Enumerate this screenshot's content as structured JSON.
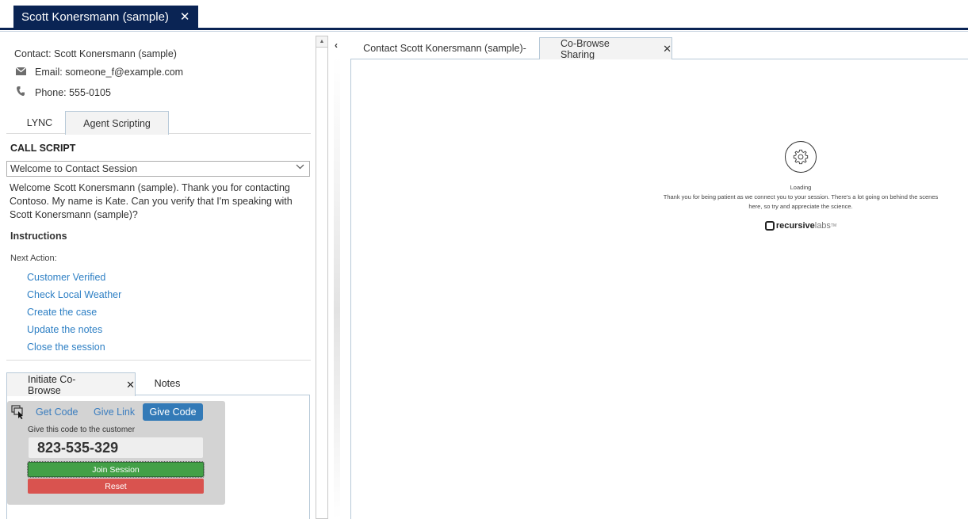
{
  "session_tab": {
    "label": "Scott Konersmann (sample)",
    "close_glyph": "✕"
  },
  "contact": {
    "title": "Contact: Scott Konersmann (sample)",
    "email": "Email: someone_f@example.com",
    "phone": "Phone: 555-0105",
    "icons": {
      "email": "envelope-icon",
      "phone": "phone-icon"
    }
  },
  "top_tabs": [
    {
      "label": "LYNC",
      "active": false
    },
    {
      "label": "Agent Scripting",
      "active": true
    }
  ],
  "call_script": {
    "heading": "CALL SCRIPT",
    "selected": "Welcome to Contact Session",
    "text": "Welcome Scott Konersmann (sample). Thank you for contacting Contoso. My name is Kate. Can you verify that I'm speaking with Scott Konersmann (sample)?"
  },
  "instructions": {
    "heading": "Instructions",
    "next_action_label": "Next Action:",
    "actions": [
      "Customer Verified",
      "Check Local Weather",
      "Create the case",
      "Update the notes",
      "Close the session"
    ]
  },
  "bottom_tabs": [
    {
      "label": "Initiate Co-Browse",
      "active": true,
      "closable": true
    },
    {
      "label": "Notes",
      "active": false
    }
  ],
  "cobrowse": {
    "get_code": "Get Code",
    "give_link": "Give Link",
    "give_code": "Give Code",
    "instruction": "Give this code to the customer",
    "code": "823-535-329",
    "join_button": "Join Session",
    "reset_button": "Reset",
    "colors": {
      "primary": "#337ab7",
      "join": "#43a047",
      "reset": "#d9534f"
    }
  },
  "collapse_glyph": "‹",
  "right_tabs": [
    {
      "label": "Contact Scott Konersmann (sample)-",
      "active": false
    },
    {
      "label": "Co-Browse Sharing",
      "active": true,
      "closable": true
    }
  ],
  "loading_panel": {
    "label": "Loading",
    "message": "Thank you for being patient as we connect you to your session. There's a lot going on behind the scenes here, so try and appreciate the science.",
    "brand_bold": "recursive",
    "brand_light": "labs",
    "brand_tm": "TM"
  },
  "theme": {
    "header_navy": "#0a2454",
    "link_blue": "#2d7fc4",
    "tab_border": "#b7c9d8"
  }
}
